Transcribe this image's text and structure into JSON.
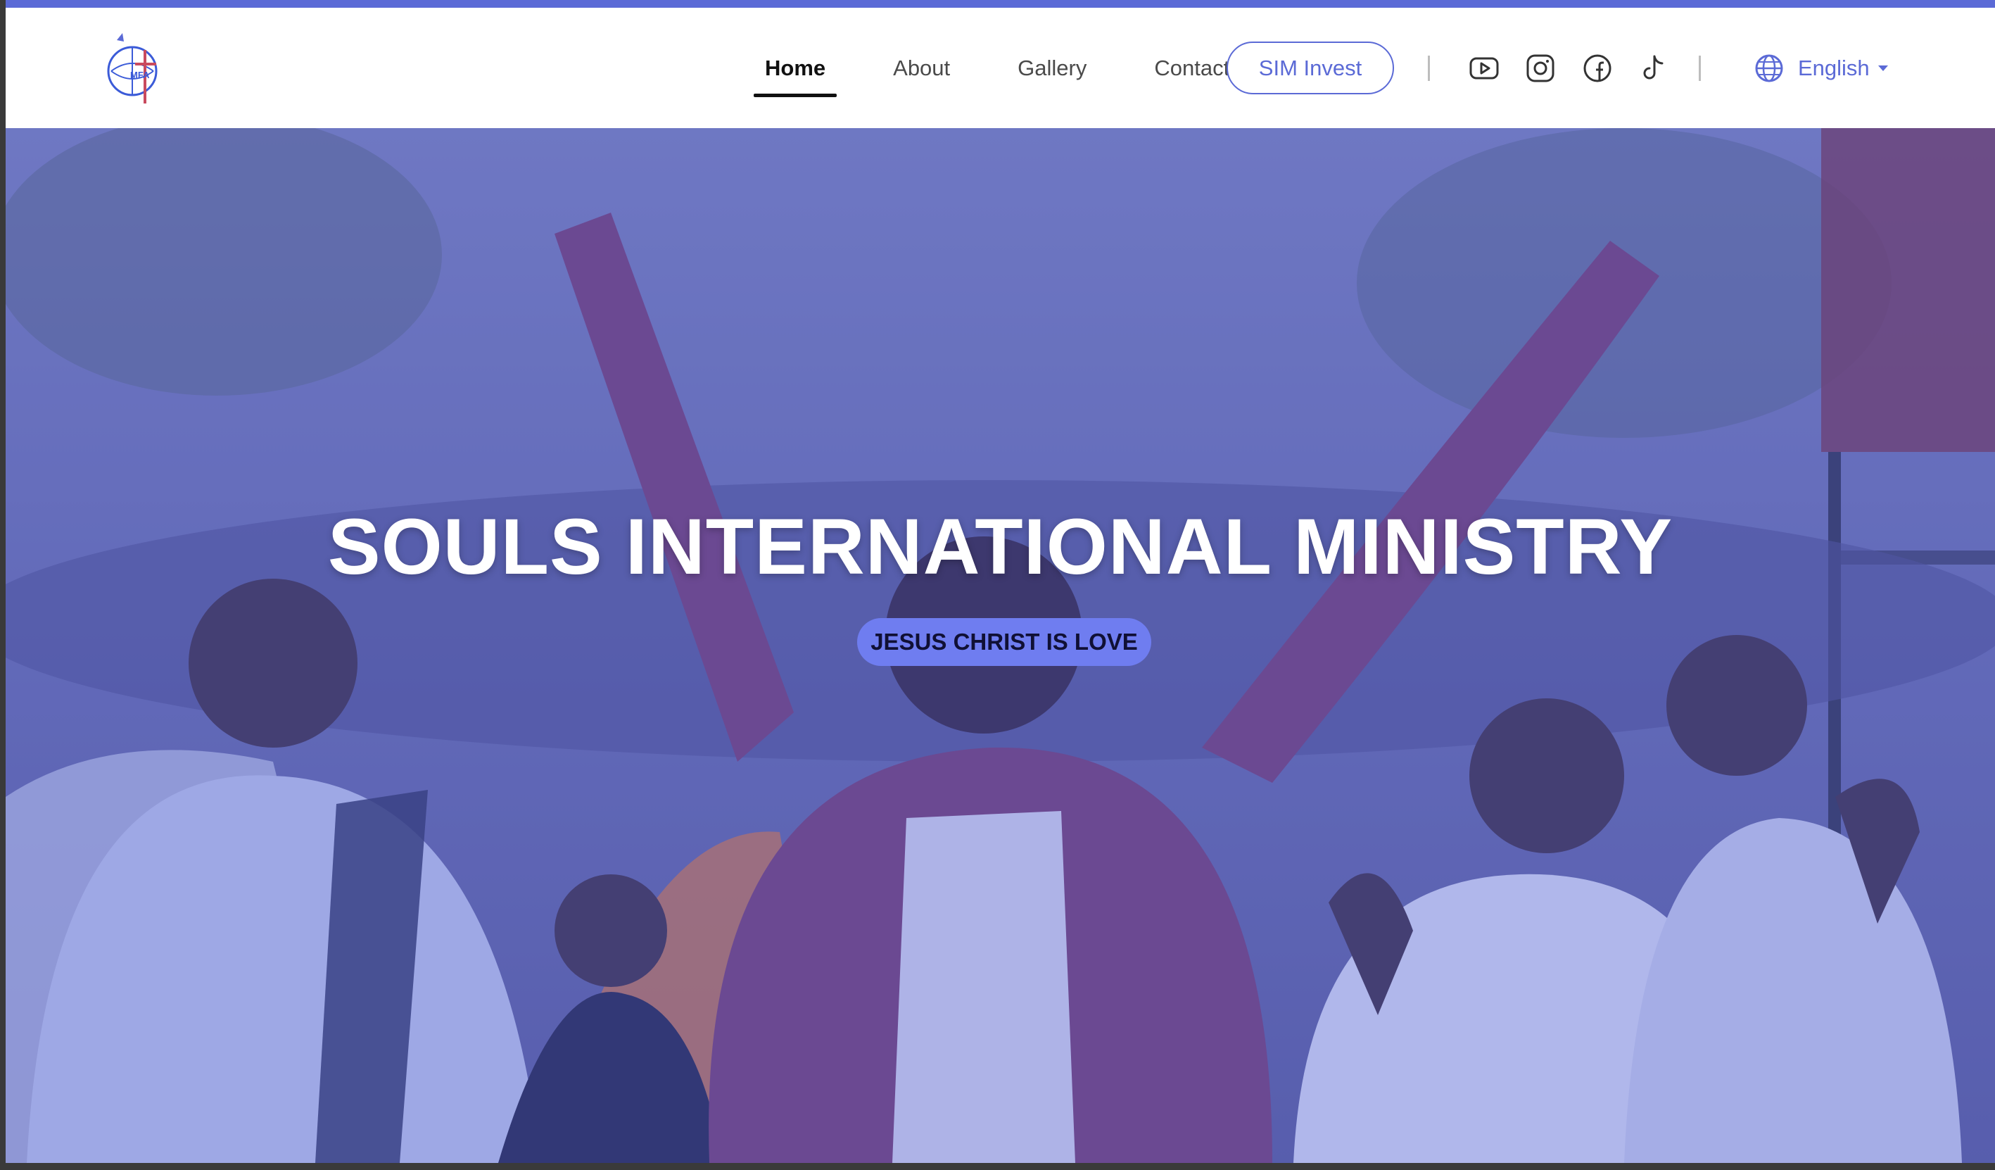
{
  "nav": {
    "logo_text": "MFA",
    "links": [
      {
        "label": "Home",
        "active": true
      },
      {
        "label": "About",
        "active": false
      },
      {
        "label": "Gallery",
        "active": false
      },
      {
        "label": "Contact Us",
        "active": false
      }
    ],
    "invest_label": "SIM Invest",
    "social_icons": [
      "youtube-icon",
      "instagram-icon",
      "facebook-icon",
      "tiktok-icon"
    ],
    "language_label": "English"
  },
  "hero": {
    "title": "SOULS INTERNATIONAL MINISTRY",
    "tagline": "JESUS CHRIST IS LOVE"
  },
  "colors": {
    "accent": "#5b6ad6",
    "pill": "#6f7df0",
    "overlay": "#5560d6"
  }
}
